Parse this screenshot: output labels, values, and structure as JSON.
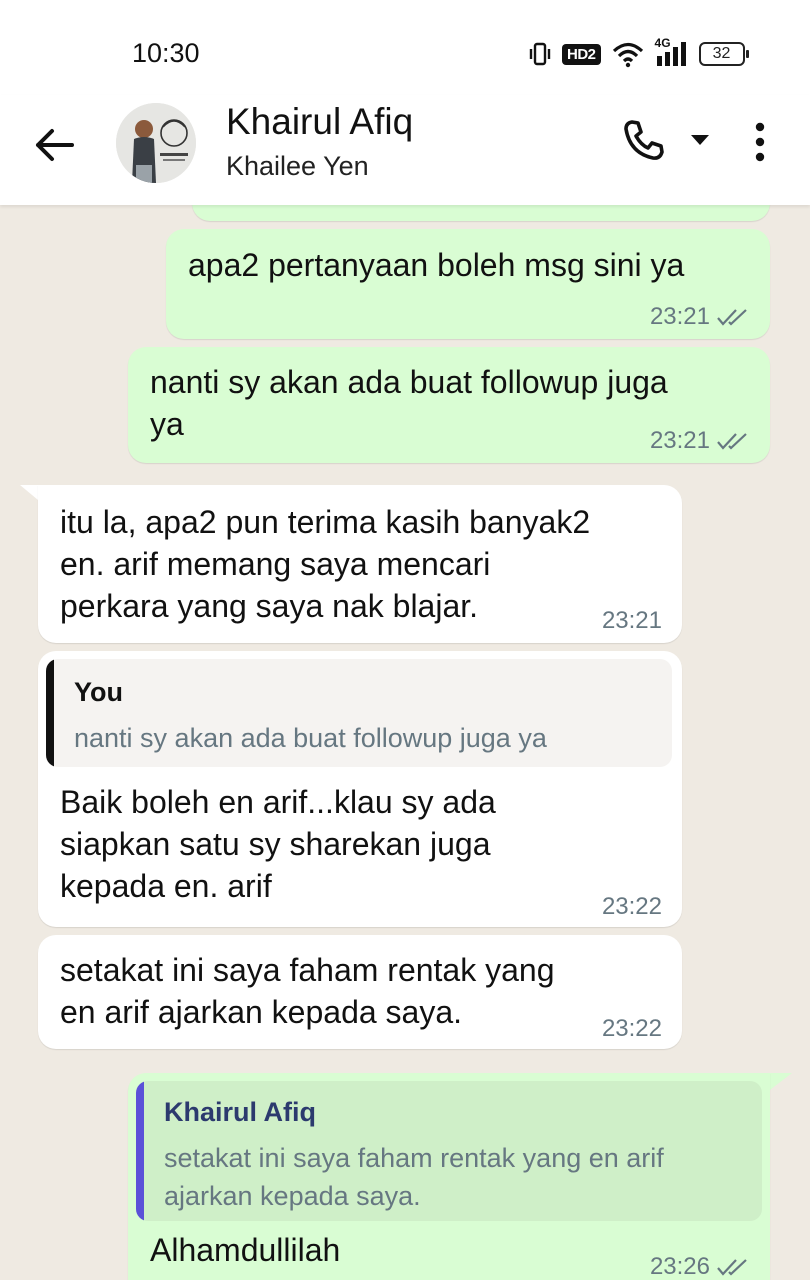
{
  "status_bar": {
    "time": "10:30",
    "network": "4G",
    "hd_badge": "HD2",
    "battery": "32"
  },
  "header": {
    "contact_name": "Khairul Afiq",
    "subtitle": "Khailee Yen",
    "icons": [
      "back-arrow-icon",
      "avatar",
      "phone-icon",
      "dropdown-caret-icon",
      "more-vert-icon"
    ]
  },
  "colors": {
    "outgoing_bubble": "#d9fdd3",
    "incoming_bubble": "#ffffff",
    "chat_background": "#efeae2",
    "read_tick": "#667781",
    "quote_bar_you": "#111111",
    "quote_bar_contact": "#5b51d8"
  },
  "messages": [
    {
      "direction": "out",
      "text": "apa2 pertanyaan boleh msg sini ya",
      "time": "23:21",
      "status": "read"
    },
    {
      "direction": "out",
      "text_line1": "nanti sy akan ada buat followup juga",
      "text_line2": "ya",
      "time": "23:21",
      "status": "read"
    },
    {
      "direction": "in",
      "text_line1": "itu la, apa2 pun terima kasih banyak2",
      "text_line2": "en. arif memang saya mencari",
      "text_line3": "perkara yang saya nak blajar.",
      "time": "23:21"
    },
    {
      "direction": "in",
      "quote_author": "You",
      "quote_text": "nanti sy akan ada buat followup juga ya",
      "text_line1": "Baik boleh en arif...klau sy ada",
      "text_line2": "siapkan satu sy sharekan juga",
      "text_line3": "kepada en. arif",
      "time": "23:22"
    },
    {
      "direction": "in",
      "text_line1": "setakat ini saya faham rentak yang",
      "text_line2": "en arif ajarkan kepada saya.",
      "time": "23:22"
    },
    {
      "direction": "out",
      "quote_author": "Khairul Afiq",
      "quote_text_line1": "setakat ini saya faham rentak yang en arif",
      "quote_text_line2": "ajarkan kepada saya.",
      "text": "Alhamdullilah",
      "time": "23:26",
      "status": "read"
    }
  ]
}
